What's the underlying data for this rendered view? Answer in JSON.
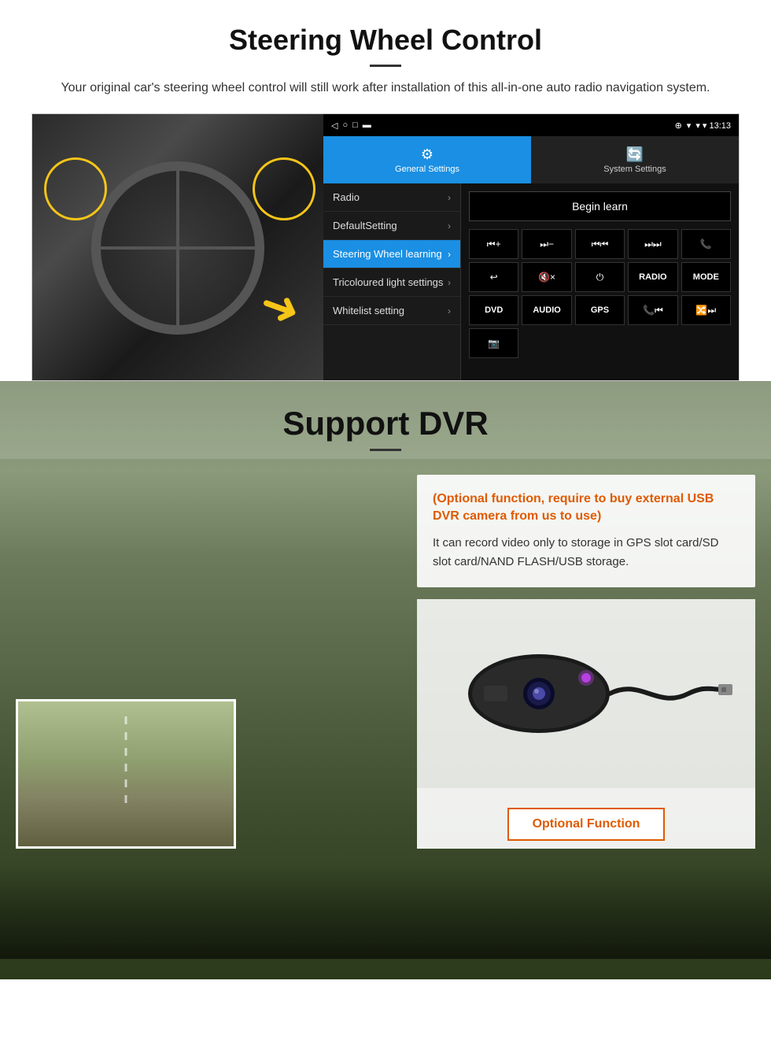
{
  "section1": {
    "title": "Steering Wheel Control",
    "description": "Your original car's steering wheel control will still work after installation of this all-in-one auto radio navigation system.",
    "statusbar": {
      "nav_icons": "◁  ○  □  ▬",
      "signal_icons": "▾ ▾ 13:13"
    },
    "tabs": {
      "general": {
        "icon": "⚙",
        "label": "General Settings",
        "active": true
      },
      "system": {
        "icon": "🔄",
        "label": "System Settings",
        "active": false
      }
    },
    "menu": [
      {
        "label": "Radio",
        "active": false
      },
      {
        "label": "DefaultSetting",
        "active": false
      },
      {
        "label": "Steering Wheel learning",
        "active": true
      },
      {
        "label": "Tricoloured light settings",
        "active": false
      },
      {
        "label": "Whitelist setting",
        "active": false
      }
    ],
    "begin_learn": "Begin learn",
    "control_buttons": [
      "⏮+",
      "⏭-",
      "⏮⏮",
      "⏭⏭",
      "📞",
      "↩",
      "🔇×",
      "⏻",
      "RADIO",
      "MODE",
      "DVD",
      "AUDIO",
      "GPS",
      "📞⏮",
      "🔀⏭"
    ]
  },
  "section2": {
    "title": "Support DVR",
    "optional_title": "(Optional function, require to buy external USB DVR camera from us to use)",
    "description": "It can record video only to storage in GPS slot card/SD slot card/NAND FLASH/USB storage.",
    "optional_function_btn": "Optional Function"
  }
}
